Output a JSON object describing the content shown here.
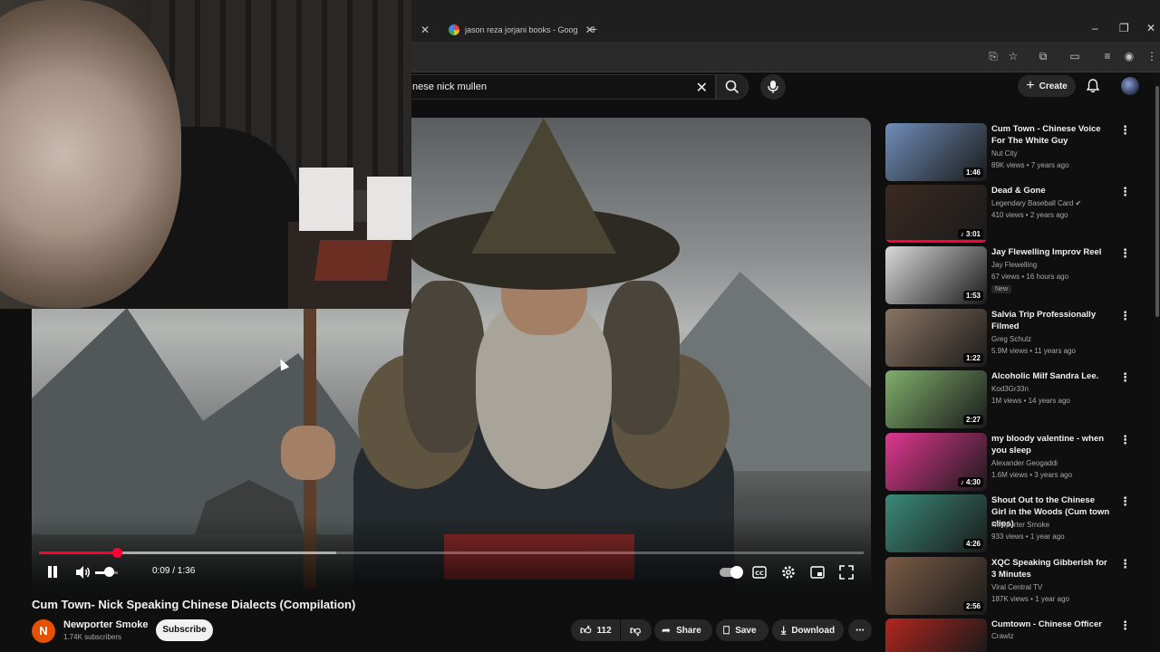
{
  "browser": {
    "tabs": [
      {
        "label": "jason reza jorjani books - Goog"
      }
    ],
    "new_tab": "+",
    "window_controls": [
      "–",
      "❐",
      "✕"
    ]
  },
  "header": {
    "search": {
      "value": "nese nick mullen"
    },
    "create_label": "Create"
  },
  "player": {
    "current_time": "0:09",
    "duration": "1:36",
    "time_text": "0:09 / 1:36",
    "progress_fraction": 0.094,
    "buffered_fraction": 0.36,
    "volume_fraction": 0.6
  },
  "video": {
    "title": "Cum Town- Nick Speaking Chinese Dialects (Compilation)",
    "channel": {
      "initial": "N",
      "name": "Newporter Smoke",
      "subscribers": "1.74K subscribers",
      "subscribe_label": "Subscribe"
    },
    "actions": {
      "likes": "112",
      "share": "Share",
      "save": "Save",
      "download": "Download"
    }
  },
  "recommendations": [
    {
      "title": "Cum Town - Chinese Voice For The White Guy",
      "channel": "Nut City",
      "meta": "89K views • 7 years ago",
      "duration": "1:46",
      "thumb_color": "#6f8db8"
    },
    {
      "title": "Dead & Gone",
      "channel": "Legendary Baseball Card",
      "verified": true,
      "meta": "410 views • 2 years ago",
      "duration": "♪ 3:01",
      "thumb_color": "#3b2a22"
    },
    {
      "title": "Jay Flewelling Improv Reel",
      "channel": "Jay Flewelling",
      "meta": "67 views • 16 hours ago",
      "badge": "New",
      "duration": "1:53",
      "thumb_color": "#d9d9d9"
    },
    {
      "title": "Salvia Trip Professionally Filmed",
      "channel": "Greg Schulz",
      "meta": "5.9M views • 11 years ago",
      "duration": "1:22",
      "thumb_color": "#8a7562"
    },
    {
      "title": "Alcoholic Milf Sandra Lee.",
      "channel": "Kod3Gr33n",
      "meta": "1M views • 14 years ago",
      "duration": "2:27",
      "thumb_color": "#7fae6b"
    },
    {
      "title": "my bloody valentine - when you sleep",
      "channel": "Alexander Geogaddi",
      "meta": "1.6M views • 3 years ago",
      "duration": "♪ 4:30",
      "thumb_color": "#e0378f"
    },
    {
      "title": "Shout Out to the Chinese Girl in the Woods (Cum town clips)",
      "channel": "Newporter Smoke",
      "meta": "933 views • 1 year ago",
      "duration": "4:26",
      "thumb_color": "#3a8a78"
    },
    {
      "title": "XQC Speaking Gibberish for 3 Minutes",
      "channel": "Viral Central TV",
      "meta": "187K views • 1 year ago",
      "duration": "2:56",
      "thumb_color": "#7a5b45"
    },
    {
      "title": "Cumtown - Chinese Officer",
      "channel": "Crawlz",
      "meta": "",
      "duration": "",
      "thumb_color": "#b3261e"
    }
  ]
}
